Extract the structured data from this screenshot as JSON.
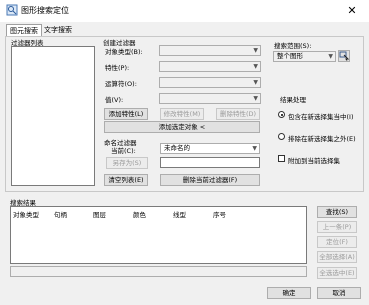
{
  "window": {
    "title": "图形搜索定位",
    "close_glyph": "✕"
  },
  "tabs": [
    "图元搜索",
    "文字搜索"
  ],
  "left": {
    "filter_list_label": "过滤器列表"
  },
  "create_filter": {
    "group_label": "创建过滤器",
    "object_type_label": "对象类型(B):",
    "property_label": "特性(P):",
    "operator_label": "运算符(O):",
    "value_label": "值(V):",
    "add_property": "添加特性(L)",
    "modify_property": "修改特性(M)",
    "delete_property": "删除特性(D)",
    "add_selected": "添加选定对象 <"
  },
  "named_filter": {
    "group_label": "命名过滤器",
    "current_label": "当前(C):",
    "current_value": "未命名的",
    "save_as": "另存为(S)",
    "clear_list": "清空列表(E)",
    "delete_current": "删除当前过滤器(F)"
  },
  "search_range": {
    "label": "搜索范围(S):",
    "value": "整个图形"
  },
  "result_processing": {
    "label": "结果处理",
    "option_include": "包含在新选择集当中(I)",
    "option_exclude": "排除在新选择集之外(E)",
    "option_append": "附加到当前选择集"
  },
  "results": {
    "label": "搜索结果",
    "columns": [
      "对象类型",
      "句柄",
      "图层",
      "颜色",
      "线型",
      "序号"
    ]
  },
  "side_buttons": {
    "find": "查找(S)",
    "prev": "上一条(P)",
    "locate": "定位(F)",
    "select_all": "全部选择(A)",
    "select_selected": "全选选中(E)"
  },
  "footer": {
    "ok": "确定",
    "cancel": "取消"
  }
}
